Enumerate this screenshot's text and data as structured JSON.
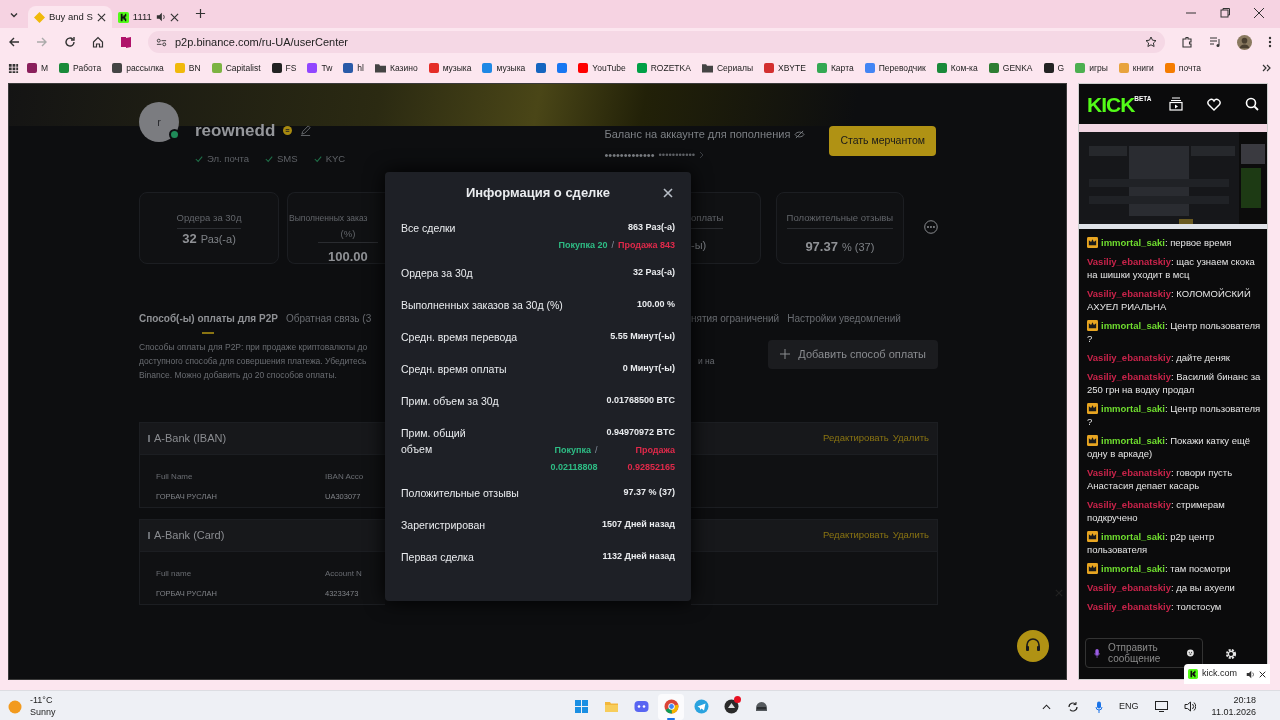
{
  "browser": {
    "tabs": [
      {
        "label": "Buy and S",
        "selected": true,
        "audio": false
      },
      {
        "label": "1111",
        "selected": false,
        "audio": true
      }
    ],
    "address": "p2p.binance.com/ru-UA/userCenter",
    "bookmarks": [
      {
        "label": "M",
        "kind": "site",
        "color": "#8a1f5c"
      },
      {
        "label": "Работа",
        "kind": "site",
        "color": "#1a8a3a"
      },
      {
        "label": "рассылка",
        "kind": "site",
        "color": "#444444"
      },
      {
        "label": "BN",
        "kind": "site",
        "color": "#f0b90b"
      },
      {
        "label": "Capitalist",
        "kind": "site",
        "color": "#7cb342"
      },
      {
        "label": "FS",
        "kind": "site",
        "color": "#222222"
      },
      {
        "label": "Tw",
        "kind": "site",
        "color": "#9146ff"
      },
      {
        "label": "hl",
        "kind": "site",
        "color": "#2a5aa8"
      },
      {
        "label": "Казино",
        "kind": "folder",
        "color": "#444444"
      },
      {
        "label": "музыка",
        "kind": "site",
        "color": "#e52d27"
      },
      {
        "label": "музыка",
        "kind": "site",
        "color": "#1e88e5"
      },
      {
        "kind": "site",
        "color": "#1565c0"
      },
      {
        "kind": "site",
        "color": "#1877f2"
      },
      {
        "label": "YouTube",
        "kind": "site",
        "color": "#ff0000"
      },
      {
        "label": "ROZETKA",
        "kind": "site",
        "color": "#00a046"
      },
      {
        "label": "Сериалы",
        "kind": "folder",
        "color": "#444444"
      },
      {
        "label": "XBYTE",
        "kind": "site",
        "color": "#d32f2f"
      },
      {
        "label": "Карта",
        "kind": "site",
        "color": "#34a853"
      },
      {
        "label": "Переводчик",
        "kind": "site",
        "color": "#4285f4"
      },
      {
        "label": "Ком-ка",
        "kind": "site",
        "color": "#1a8a3a"
      },
      {
        "label": "GENKA",
        "kind": "site",
        "color": "#2e7d32"
      },
      {
        "label": "G",
        "kind": "site",
        "color": "#222222"
      },
      {
        "label": "игры",
        "kind": "site",
        "color": "#4caf50"
      },
      {
        "label": "книги",
        "kind": "site",
        "color": "#e8a33d"
      },
      {
        "label": "почта",
        "kind": "site",
        "color": "#f57c00"
      }
    ]
  },
  "page": {
    "profile": {
      "avatar_letter": "r",
      "online": true,
      "name": "reownedd",
      "verifications": [
        "Эл. почта",
        "SMS",
        "KYC"
      ]
    },
    "balance": {
      "label": "Баланс на аккаунте для пополнения",
      "masked": "•••••••••••••",
      "masked_secondary": "•••••••••••"
    },
    "merchant_button": "Стать мерчантом",
    "left": {
      "stats": [
        {
          "label": "Ордера за 30д",
          "value": "32",
          "unit": "Раз(-а)"
        },
        {
          "label": "Выполненных заказ",
          "label_2": "(%)",
          "value": "100.00"
        }
      ],
      "tabs": [
        {
          "label": "Способ(-ы) оплаты для P2P",
          "selected": true
        },
        {
          "label": "Обратная связь (3",
          "selected": false
        }
      ],
      "description": [
        "Способы оплаты для P2P: при продаже криптовалюты до",
        "доступного способа для совершения платежа. Убедитесь",
        "Binance. Можно добавить до 20 способов оплаты."
      ],
      "banks": [
        {
          "name": "A-Bank (IBAN)",
          "fields": [
            {
              "label": "Full Name",
              "value": "ГОРБАЧ РУСЛАН"
            },
            {
              "label": "IBAN Acco",
              "value": "UA303077"
            }
          ]
        },
        {
          "name": "A-Bank (Card)",
          "fields": [
            {
              "label": "Full name",
              "value": "ГОРБАЧ РУСЛАН"
            },
            {
              "label": "Account N",
              "value": "43233473"
            }
          ]
        }
      ]
    },
    "right": {
      "stats": [
        {
          "label": "оплаты",
          "value": "-ы)"
        },
        {
          "label": "Положительные отзывы",
          "value": "97.37",
          "unit": "% (37)"
        }
      ],
      "tabs": [
        {
          "label": "нятия ограничений",
          "selected": false
        },
        {
          "label": "Настройки уведомлений",
          "selected": false
        }
      ],
      "add_button": "Добавить способ оплаты",
      "description": "и на",
      "banks": [
        {
          "actions": [
            "Редактировать",
            "Удалить"
          ]
        },
        {
          "actions": [
            "Редактировать",
            "Удалить"
          ]
        }
      ]
    }
  },
  "modal": {
    "title": "Информация о сделке",
    "rows": [
      {
        "label": "Все сделки",
        "value": "863 Раз(-а)",
        "split": {
          "kind": "inline",
          "buy": "Покупка 20",
          "separator": "/",
          "sell": "Продажа 843"
        }
      },
      {
        "label": "Ордера за 30д",
        "value": "32 Раз(-а)"
      },
      {
        "label": "Выполненных заказов за 30д (%)",
        "value": "100.00 %"
      },
      {
        "label": "Средн. время перевода",
        "value": "5.55 Минут(-ы)"
      },
      {
        "label": "Средн. время оплаты",
        "value": "0 Минут(-ы)"
      },
      {
        "label": "Прим. объем за 30д",
        "value": "0.01768500 BTC"
      },
      {
        "label": "Прим. общий объем",
        "value": "0.94970972 BTC",
        "split": {
          "kind": "columns",
          "buy_label": "Покупка",
          "separator": "/",
          "buy": "0.02118808",
          "sell_label": "Продажа",
          "sell": "0.92852165"
        }
      },
      {
        "label": "Положительные отзывы",
        "value": "97.37 % (37)"
      },
      {
        "label": "Зарегистрирован",
        "value": "1507 Дней назад"
      },
      {
        "label": "Первая сделка",
        "value": "1132 Дней назад"
      }
    ]
  },
  "kick": {
    "logo": "KICK",
    "logo_tag": "BETA",
    "messages": [
      {
        "user": "immortal_saki",
        "crown": true,
        "color": "#6fdc2f",
        "text": ": первое время"
      },
      {
        "user": "Vasiliy_ebanatskiy",
        "crown": false,
        "color": "#c8234a",
        "text": ": щас узнаем скока на шишки уходит в мсц"
      },
      {
        "user": "Vasiliy_ebanatskiy",
        "crown": false,
        "color": "#c8234a",
        "text": ": КОЛОМОЙСКИЙ АХУЕЛ РИАЛЬНА"
      },
      {
        "user": "immortal_saki",
        "crown": true,
        "color": "#6fdc2f",
        "text": ": Центр пользователя ?"
      },
      {
        "user": "Vasiliy_ebanatskiy",
        "crown": false,
        "color": "#c8234a",
        "text": ": дайте деняк"
      },
      {
        "user": "Vasiliy_ebanatskiy",
        "crown": false,
        "color": "#c8234a",
        "text": ": Василий бинанс за 250 грн на водку продал"
      },
      {
        "user": "immortal_saki",
        "crown": true,
        "color": "#6fdc2f",
        "text": ": Центр пользователя ?"
      },
      {
        "user": "immortal_saki",
        "crown": true,
        "color": "#6fdc2f",
        "text": ": Покажи катку ещё одну в аркаде)"
      },
      {
        "user": "Vasiliy_ebanatskiy",
        "crown": false,
        "color": "#c8234a",
        "text": ": говори пусть Анастасия депает касарь"
      },
      {
        "user": "Vasiliy_ebanatskiy",
        "crown": false,
        "color": "#c8234a",
        "text": ": стримерам подкручено"
      },
      {
        "user": "immortal_saki",
        "crown": true,
        "color": "#6fdc2f",
        "text": ": p2p центр пользователя"
      },
      {
        "user": "immortal_saki",
        "crown": true,
        "color": "#6fdc2f",
        "text": ": там посмотри"
      },
      {
        "user": "Vasiliy_ebanatskiy",
        "crown": false,
        "color": "#c8234a",
        "text": ": да вы ахуели"
      },
      {
        "user": "Vasiliy_ebanatskiy",
        "crown": false,
        "color": "#c8234a",
        "text": ": толстосум"
      }
    ],
    "input_placeholder": "Отправить сообщение",
    "notification": "kick.com"
  },
  "taskbar": {
    "weather": {
      "temp": "-11°C",
      "condition": "Sunny"
    },
    "apps": [
      {
        "kind": "start",
        "active": false,
        "alert": false
      },
      {
        "kind": "folder",
        "active": false,
        "alert": false
      },
      {
        "kind": "discord",
        "active": false,
        "alert": false
      },
      {
        "kind": "browser",
        "active": true,
        "alert": false
      },
      {
        "kind": "telegram",
        "active": false,
        "alert": false
      },
      {
        "kind": "game",
        "active": false,
        "alert": true
      },
      {
        "kind": "helmet",
        "active": false,
        "alert": false
      }
    ],
    "language": "ENG",
    "time": "20:18",
    "date": "11.01.2026"
  }
}
